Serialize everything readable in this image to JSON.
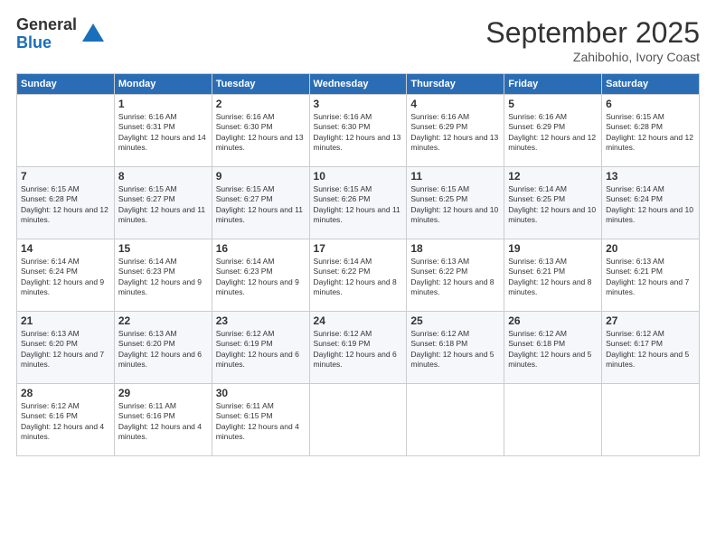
{
  "logo": {
    "general": "General",
    "blue": "Blue"
  },
  "title": "September 2025",
  "location": "Zahibohio, Ivory Coast",
  "days_header": [
    "Sunday",
    "Monday",
    "Tuesday",
    "Wednesday",
    "Thursday",
    "Friday",
    "Saturday"
  ],
  "weeks": [
    [
      {
        "num": "",
        "sunrise": "",
        "sunset": "",
        "daylight": ""
      },
      {
        "num": "1",
        "sunrise": "Sunrise: 6:16 AM",
        "sunset": "Sunset: 6:31 PM",
        "daylight": "Daylight: 12 hours and 14 minutes."
      },
      {
        "num": "2",
        "sunrise": "Sunrise: 6:16 AM",
        "sunset": "Sunset: 6:30 PM",
        "daylight": "Daylight: 12 hours and 13 minutes."
      },
      {
        "num": "3",
        "sunrise": "Sunrise: 6:16 AM",
        "sunset": "Sunset: 6:30 PM",
        "daylight": "Daylight: 12 hours and 13 minutes."
      },
      {
        "num": "4",
        "sunrise": "Sunrise: 6:16 AM",
        "sunset": "Sunset: 6:29 PM",
        "daylight": "Daylight: 12 hours and 13 minutes."
      },
      {
        "num": "5",
        "sunrise": "Sunrise: 6:16 AM",
        "sunset": "Sunset: 6:29 PM",
        "daylight": "Daylight: 12 hours and 12 minutes."
      },
      {
        "num": "6",
        "sunrise": "Sunrise: 6:15 AM",
        "sunset": "Sunset: 6:28 PM",
        "daylight": "Daylight: 12 hours and 12 minutes."
      }
    ],
    [
      {
        "num": "7",
        "sunrise": "Sunrise: 6:15 AM",
        "sunset": "Sunset: 6:28 PM",
        "daylight": "Daylight: 12 hours and 12 minutes."
      },
      {
        "num": "8",
        "sunrise": "Sunrise: 6:15 AM",
        "sunset": "Sunset: 6:27 PM",
        "daylight": "Daylight: 12 hours and 11 minutes."
      },
      {
        "num": "9",
        "sunrise": "Sunrise: 6:15 AM",
        "sunset": "Sunset: 6:27 PM",
        "daylight": "Daylight: 12 hours and 11 minutes."
      },
      {
        "num": "10",
        "sunrise": "Sunrise: 6:15 AM",
        "sunset": "Sunset: 6:26 PM",
        "daylight": "Daylight: 12 hours and 11 minutes."
      },
      {
        "num": "11",
        "sunrise": "Sunrise: 6:15 AM",
        "sunset": "Sunset: 6:25 PM",
        "daylight": "Daylight: 12 hours and 10 minutes."
      },
      {
        "num": "12",
        "sunrise": "Sunrise: 6:14 AM",
        "sunset": "Sunset: 6:25 PM",
        "daylight": "Daylight: 12 hours and 10 minutes."
      },
      {
        "num": "13",
        "sunrise": "Sunrise: 6:14 AM",
        "sunset": "Sunset: 6:24 PM",
        "daylight": "Daylight: 12 hours and 10 minutes."
      }
    ],
    [
      {
        "num": "14",
        "sunrise": "Sunrise: 6:14 AM",
        "sunset": "Sunset: 6:24 PM",
        "daylight": "Daylight: 12 hours and 9 minutes."
      },
      {
        "num": "15",
        "sunrise": "Sunrise: 6:14 AM",
        "sunset": "Sunset: 6:23 PM",
        "daylight": "Daylight: 12 hours and 9 minutes."
      },
      {
        "num": "16",
        "sunrise": "Sunrise: 6:14 AM",
        "sunset": "Sunset: 6:23 PM",
        "daylight": "Daylight: 12 hours and 9 minutes."
      },
      {
        "num": "17",
        "sunrise": "Sunrise: 6:14 AM",
        "sunset": "Sunset: 6:22 PM",
        "daylight": "Daylight: 12 hours and 8 minutes."
      },
      {
        "num": "18",
        "sunrise": "Sunrise: 6:13 AM",
        "sunset": "Sunset: 6:22 PM",
        "daylight": "Daylight: 12 hours and 8 minutes."
      },
      {
        "num": "19",
        "sunrise": "Sunrise: 6:13 AM",
        "sunset": "Sunset: 6:21 PM",
        "daylight": "Daylight: 12 hours and 8 minutes."
      },
      {
        "num": "20",
        "sunrise": "Sunrise: 6:13 AM",
        "sunset": "Sunset: 6:21 PM",
        "daylight": "Daylight: 12 hours and 7 minutes."
      }
    ],
    [
      {
        "num": "21",
        "sunrise": "Sunrise: 6:13 AM",
        "sunset": "Sunset: 6:20 PM",
        "daylight": "Daylight: 12 hours and 7 minutes."
      },
      {
        "num": "22",
        "sunrise": "Sunrise: 6:13 AM",
        "sunset": "Sunset: 6:20 PM",
        "daylight": "Daylight: 12 hours and 6 minutes."
      },
      {
        "num": "23",
        "sunrise": "Sunrise: 6:12 AM",
        "sunset": "Sunset: 6:19 PM",
        "daylight": "Daylight: 12 hours and 6 minutes."
      },
      {
        "num": "24",
        "sunrise": "Sunrise: 6:12 AM",
        "sunset": "Sunset: 6:19 PM",
        "daylight": "Daylight: 12 hours and 6 minutes."
      },
      {
        "num": "25",
        "sunrise": "Sunrise: 6:12 AM",
        "sunset": "Sunset: 6:18 PM",
        "daylight": "Daylight: 12 hours and 5 minutes."
      },
      {
        "num": "26",
        "sunrise": "Sunrise: 6:12 AM",
        "sunset": "Sunset: 6:18 PM",
        "daylight": "Daylight: 12 hours and 5 minutes."
      },
      {
        "num": "27",
        "sunrise": "Sunrise: 6:12 AM",
        "sunset": "Sunset: 6:17 PM",
        "daylight": "Daylight: 12 hours and 5 minutes."
      }
    ],
    [
      {
        "num": "28",
        "sunrise": "Sunrise: 6:12 AM",
        "sunset": "Sunset: 6:16 PM",
        "daylight": "Daylight: 12 hours and 4 minutes."
      },
      {
        "num": "29",
        "sunrise": "Sunrise: 6:11 AM",
        "sunset": "Sunset: 6:16 PM",
        "daylight": "Daylight: 12 hours and 4 minutes."
      },
      {
        "num": "30",
        "sunrise": "Sunrise: 6:11 AM",
        "sunset": "Sunset: 6:15 PM",
        "daylight": "Daylight: 12 hours and 4 minutes."
      },
      {
        "num": "",
        "sunrise": "",
        "sunset": "",
        "daylight": ""
      },
      {
        "num": "",
        "sunrise": "",
        "sunset": "",
        "daylight": ""
      },
      {
        "num": "",
        "sunrise": "",
        "sunset": "",
        "daylight": ""
      },
      {
        "num": "",
        "sunrise": "",
        "sunset": "",
        "daylight": ""
      }
    ]
  ]
}
